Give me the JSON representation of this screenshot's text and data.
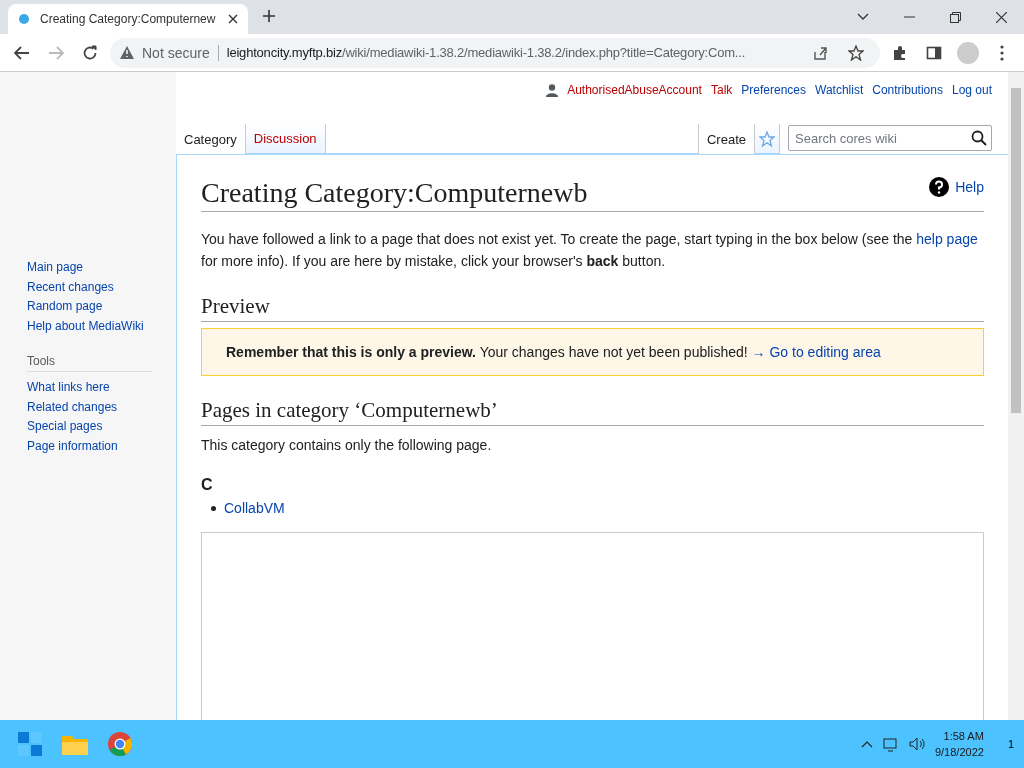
{
  "browser": {
    "tab_title": "Creating Category:Computernew",
    "security": "Not secure",
    "url_host": "leightoncity.myftp.biz",
    "url_path": "/wiki/mediawiki-1.38.2/mediawiki-1.38.2/index.php?title=Category:Com..."
  },
  "user_links": [
    {
      "label": "AuthorisedAbuseAccount",
      "red_link": true
    },
    {
      "label": "Talk",
      "red_link": true
    },
    {
      "label": "Preferences",
      "red_link": false
    },
    {
      "label": "Watchlist",
      "red_link": false
    },
    {
      "label": "Contributions",
      "red_link": false
    },
    {
      "label": "Log out",
      "red_link": false
    }
  ],
  "namespace_tabs": [
    {
      "label": "Category",
      "selected": true,
      "red_link": false
    },
    {
      "label": "Discussion",
      "selected": false,
      "red_link": true
    }
  ],
  "view_tabs": [
    {
      "label": "Create",
      "selected": true
    }
  ],
  "search": {
    "placeholder": "Search cores wiki"
  },
  "sidebar": {
    "navigation": [
      "Main page",
      "Recent changes",
      "Random page",
      "Help about MediaWiki"
    ],
    "tools": {
      "heading": "Tools",
      "items": [
        "What links here",
        "Related changes",
        "Special pages",
        "Page information"
      ]
    }
  },
  "content": {
    "title": "Creating Category:Computernewb",
    "help": "Help",
    "intro_before": "You have followed a link to a page that does not exist yet. To create the page, start typing in the box below (see the ",
    "intro_link": "help page",
    "intro_after": " for more info). If you are here by mistake, click your browser's **back** button.",
    "preview_heading": "Preview",
    "preview_notice": "**Remember that this is only a preview.** Your changes have not yet been published!",
    "preview_link": "→ Go to editing area",
    "category_heading": "Pages in category ‘Computernewb’",
    "category_text": "This category contains only the following page.",
    "groups": [
      {
        "letter": "C",
        "pages": [
          "CollabVM"
        ]
      }
    ]
  },
  "taskbar": {
    "time": "1:58 AM",
    "date": "9/18/2022",
    "notifications": "1"
  }
}
